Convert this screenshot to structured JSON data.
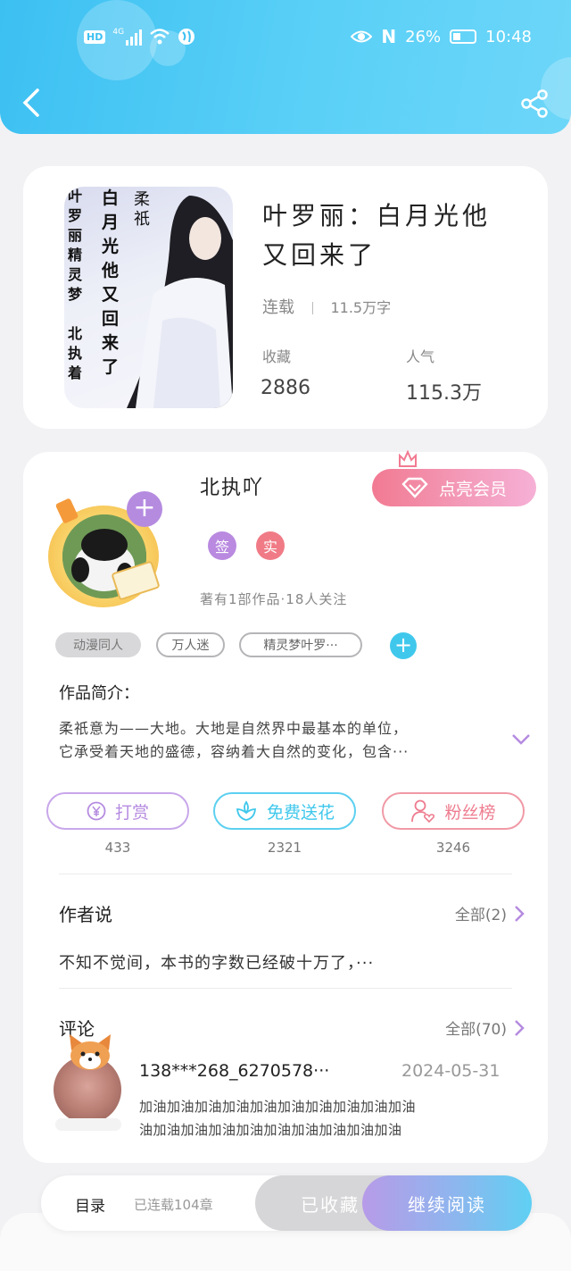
{
  "status_bar": {
    "left_badge": "HD",
    "network": "4G",
    "right_n": "N",
    "battery": "26%",
    "time": "10:48"
  },
  "book": {
    "cover_text_right": "柔\n祇",
    "cover_text_mid": "白\n月\n光\n他\n又\n回\n来\n了",
    "cover_text_left": "叶\n罗\n丽\n精\n灵\n梦\n\n北\n执\n着",
    "title": "叶罗丽：白月光他又回来了",
    "status": "连载",
    "word_count": "11.5万字",
    "collect_label": "收藏",
    "collect_value": "2886",
    "popularity_label": "人气",
    "popularity_value": "115.3万"
  },
  "author": {
    "name": "北执吖",
    "vip_button": "点亮会员",
    "badge_sign": "签",
    "badge_real": "实",
    "summary": "著有1部作品·18人关注",
    "tags": [
      "动漫同人",
      "万人迷",
      "精灵梦叶罗···"
    ]
  },
  "intro": {
    "heading": "作品简介：",
    "line1": "柔祇意为——大地。大地是自然界中最基本的单位，",
    "line2": "它承受着天地的盛德，容纳着大自然的变化，包含···"
  },
  "actions": [
    {
      "label": "打赏",
      "count": "433",
      "color": "#b58be0"
    },
    {
      "label": "免费送花",
      "count": "2321",
      "color": "#40c8ec"
    },
    {
      "label": "粉丝榜",
      "count": "3246",
      "color": "#ee7c8f"
    }
  ],
  "author_says": {
    "heading": "作者说",
    "all_link": "全部(2)",
    "text": "不知不觉间，本书的字数已经破十万了，···"
  },
  "comments": {
    "heading": "评论",
    "all_link": "全部(70)",
    "user": "138***268_6270578···",
    "date": "2024-05-31",
    "line1": "加油加油加油加油加油加油加油加油加油加油",
    "line2": "油加油加油加油加油加油加油加油加油加油"
  },
  "bottom": {
    "toc": "目录",
    "chapters": "已连载104章",
    "collected": "已收藏",
    "continue": "继续阅读"
  },
  "colors": {
    "header": "#3cc0f2",
    "vip": "#f27a92",
    "purple": "#b58be0",
    "cyan": "#40c8ec",
    "pink": "#ee7c8f"
  }
}
